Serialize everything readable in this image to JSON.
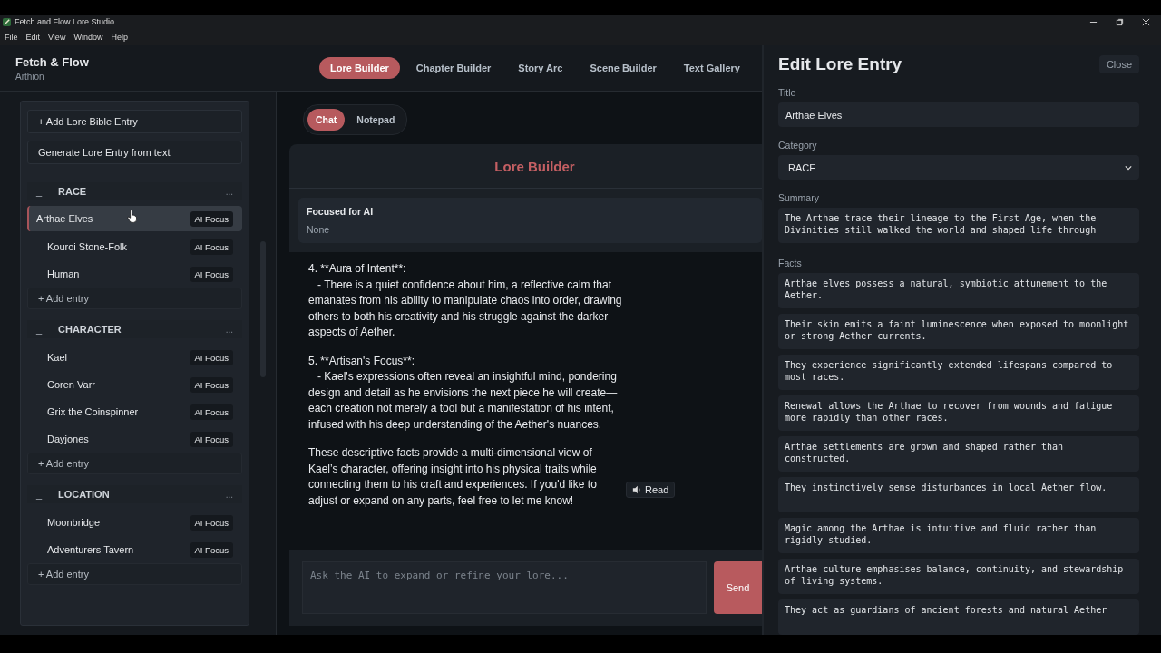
{
  "window": {
    "title": "Fetch and Flow Lore Studio"
  },
  "menu": [
    "File",
    "Edit",
    "View",
    "Window",
    "Help"
  ],
  "brand": {
    "title": "Fetch & Flow",
    "subtitle": "Arthion"
  },
  "nav_tabs": [
    {
      "label": "Lore Builder",
      "selected": true
    },
    {
      "label": "Chapter Builder",
      "selected": false
    },
    {
      "label": "Story Arc",
      "selected": false
    },
    {
      "label": "Scene Builder",
      "selected": false
    },
    {
      "label": "Text Gallery",
      "selected": false
    }
  ],
  "sidebar": {
    "actions": [
      "+ Add Lore Bible Entry",
      "Generate Lore Entry from text"
    ],
    "sections": [
      {
        "name": "RACE",
        "collapse": "_",
        "more": "...",
        "add": "+ Add entry",
        "entries": [
          {
            "name": "Arthae Elves",
            "badge": "AI Focus",
            "selected": true
          },
          {
            "name": "Kouroi Stone-Folk",
            "badge": "AI Focus",
            "selected": false
          },
          {
            "name": "Human",
            "badge": "AI Focus",
            "selected": false
          }
        ]
      },
      {
        "name": "CHARACTER",
        "collapse": "_",
        "more": "...",
        "add": "+ Add entry",
        "entries": [
          {
            "name": "Kael",
            "badge": "AI Focus",
            "selected": false
          },
          {
            "name": "Coren Varr",
            "badge": "AI Focus",
            "selected": false
          },
          {
            "name": "Grix the Coinspinner",
            "badge": "AI Focus",
            "selected": false
          },
          {
            "name": "Dayjones",
            "badge": "AI Focus",
            "selected": false
          }
        ]
      },
      {
        "name": "LOCATION",
        "collapse": "_",
        "more": "...",
        "add": "+ Add entry",
        "entries": [
          {
            "name": "Moonbridge",
            "badge": "AI Focus",
            "selected": false
          },
          {
            "name": "Adventurers Tavern",
            "badge": "AI Focus",
            "selected": false
          }
        ]
      }
    ]
  },
  "chat": {
    "modes": [
      {
        "label": "Chat",
        "selected": true
      },
      {
        "label": "Notepad",
        "selected": false
      }
    ],
    "heading": "Lore Builder",
    "focus": {
      "label": "Focused for AI",
      "value": "None"
    },
    "message": [
      "4. **Aura of Intent**:\n   - There is a quiet confidence about him, a reflective calm that emanates from his ability to manipulate chaos into order, drawing others to both his creativity and his struggle against the darker aspects of Aether.",
      "5. **Artisan's Focus**:\n   - Kael's expressions often reveal an insightful mind, pondering design and detail as he envisions the next piece he will create—each creation not merely a tool but a manifestation of his intent, infused with his deep understanding of the Aether's nuances.",
      "These descriptive facts provide a multi-dimensional view of Kael’s character, offering insight into his physical traits while connecting them to his craft and experiences. If you'd like to adjust or expand on any parts, feel free to let me know!"
    ],
    "read_button": "Read",
    "input": {
      "placeholder": "Ask the AI to expand or refine your lore..."
    },
    "send": "Send"
  },
  "editor": {
    "title": "Edit Lore Entry",
    "close": "Close",
    "title_label": "Title",
    "title_value": "Arthae Elves",
    "category_label": "Category",
    "category_value": "RACE",
    "summary_label": "Summary",
    "summary_value": "The Arthae trace their lineage to the First Age, when the Divinities still walked the world and shaped life through",
    "facts_label": "Facts",
    "facts": [
      "Arthae elves possess a natural, symbiotic attunement to the Aether.",
      "Their skin emits a faint luminescence when exposed to moonlight or strong Aether currents.",
      "They experience significantly extended lifespans compared to most races.",
      "Renewal allows the Arthae to recover from wounds and fatigue more rapidly than other races.",
      "Arthae settlements are grown and shaped rather than constructed.",
      "They instinctively sense disturbances in local Aether flow.",
      "Magic among the Arthae is intuitive and fluid rather than rigidly studied.",
      "Arthae culture emphasises balance, continuity, and stewardship of living systems.",
      "They act as guardians of ancient forests and natural Aether"
    ]
  }
}
